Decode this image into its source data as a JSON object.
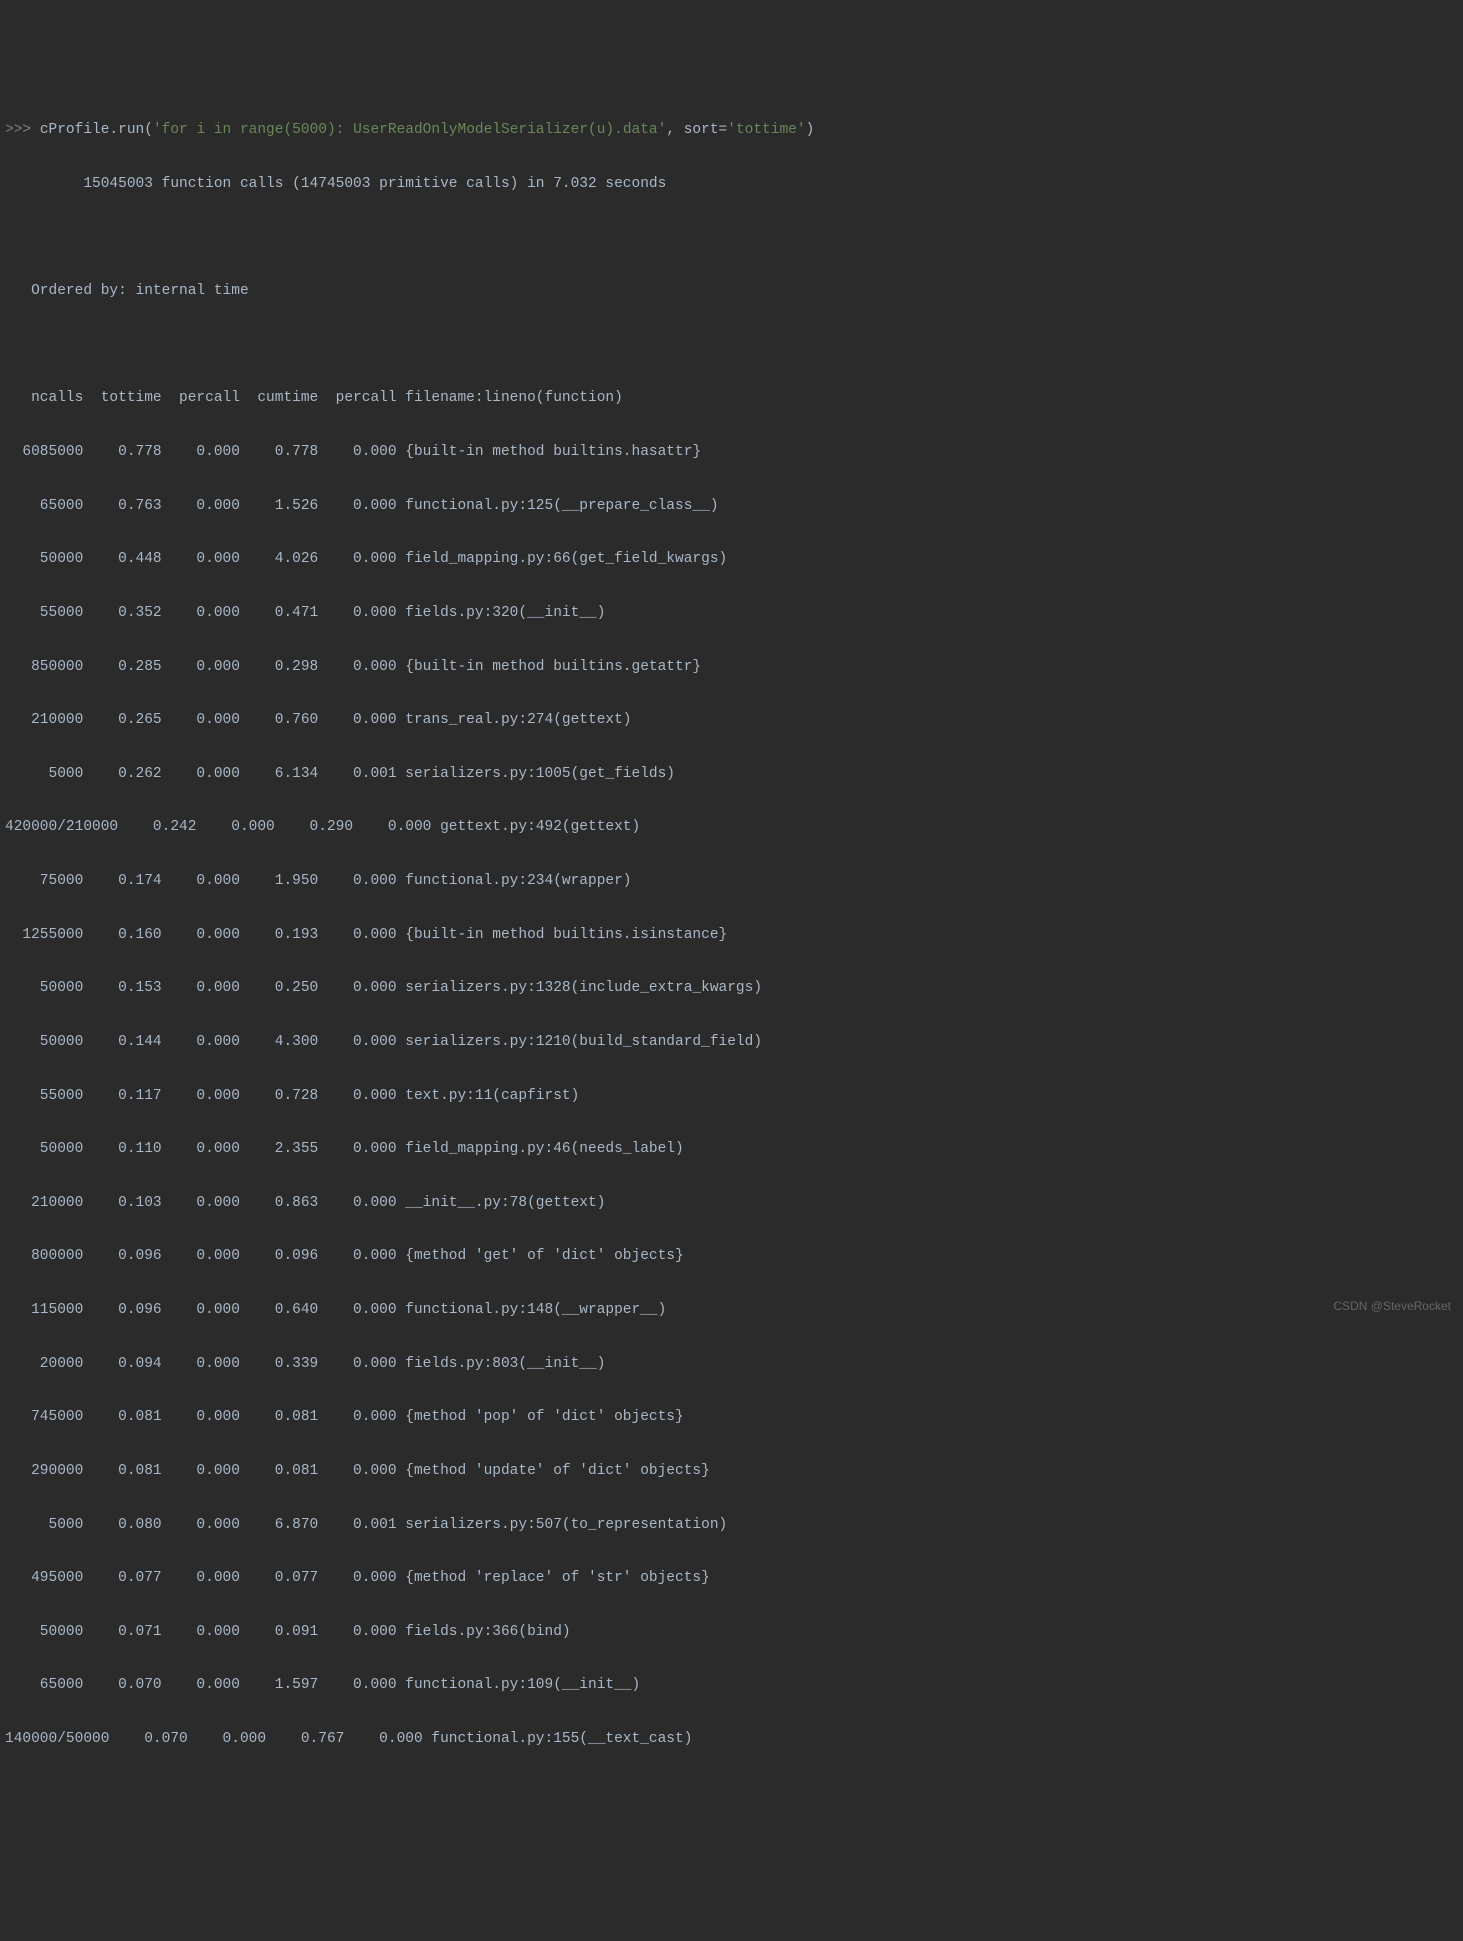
{
  "prompt": ">>> ",
  "command": {
    "prefix": "cProfile.run(",
    "string1": "'for i in range(5000): UserReadOnlyModelSerializer(u).data'",
    "sep": ", sort=",
    "string2": "'tottime'",
    "suffix": ")"
  },
  "summary_line": "         15045003 function calls (14745003 primitive calls) in 7.032 seconds",
  "ordered_by": "   Ordered by: internal time",
  "header": "   ncalls  tottime  percall  cumtime  percall filename:lineno(function)",
  "rows": [
    "  6085000    0.778    0.000    0.778    0.000 {built-in method builtins.hasattr}",
    "    65000    0.763    0.000    1.526    0.000 functional.py:125(__prepare_class__)",
    "    50000    0.448    0.000    4.026    0.000 field_mapping.py:66(get_field_kwargs)",
    "    55000    0.352    0.000    0.471    0.000 fields.py:320(__init__)",
    "   850000    0.285    0.000    0.298    0.000 {built-in method builtins.getattr}",
    "   210000    0.265    0.000    0.760    0.000 trans_real.py:274(gettext)",
    "     5000    0.262    0.000    6.134    0.001 serializers.py:1005(get_fields)",
    "420000/210000    0.242    0.000    0.290    0.000 gettext.py:492(gettext)",
    "    75000    0.174    0.000    1.950    0.000 functional.py:234(wrapper)",
    "  1255000    0.160    0.000    0.193    0.000 {built-in method builtins.isinstance}",
    "    50000    0.153    0.000    0.250    0.000 serializers.py:1328(include_extra_kwargs)",
    "    50000    0.144    0.000    4.300    0.000 serializers.py:1210(build_standard_field)",
    "    55000    0.117    0.000    0.728    0.000 text.py:11(capfirst)",
    "    50000    0.110    0.000    2.355    0.000 field_mapping.py:46(needs_label)",
    "   210000    0.103    0.000    0.863    0.000 __init__.py:78(gettext)",
    "   800000    0.096    0.000    0.096    0.000 {method 'get' of 'dict' objects}",
    "   115000    0.096    0.000    0.640    0.000 functional.py:148(__wrapper__)",
    "    20000    0.094    0.000    0.339    0.000 fields.py:803(__init__)",
    "   745000    0.081    0.000    0.081    0.000 {method 'pop' of 'dict' objects}",
    "   290000    0.081    0.000    0.081    0.000 {method 'update' of 'dict' objects}",
    "     5000    0.080    0.000    6.870    0.001 serializers.py:507(to_representation)",
    "   495000    0.077    0.000    0.077    0.000 {method 'replace' of 'str' objects}",
    "    50000    0.071    0.000    0.091    0.000 fields.py:366(bind)",
    "    65000    0.070    0.000    1.597    0.000 functional.py:109(__init__)",
    "140000/50000    0.070    0.000    0.767    0.000 functional.py:155(__text_cast)"
  ],
  "watermark": "CSDN @SteveRocket"
}
